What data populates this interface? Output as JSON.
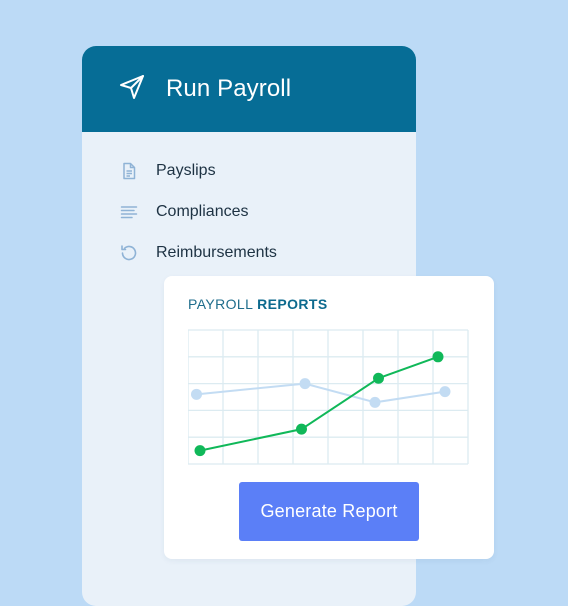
{
  "header": {
    "title": "Run Payroll",
    "icon": "send-icon"
  },
  "menu": {
    "items": [
      {
        "label": "Payslips",
        "icon": "document-icon"
      },
      {
        "label": "Compliances",
        "icon": "lines-icon"
      },
      {
        "label": "Reimbursements",
        "icon": "history-icon"
      }
    ]
  },
  "card": {
    "title_part1": "PAYROLL",
    "title_part2": "REPORTS",
    "button_label": "Generate Report"
  },
  "colors": {
    "header_bg": "#066d96",
    "panel_bg": "#e9f1f9",
    "page_bg": "#bcdaf6",
    "button_bg": "#5b7ff7",
    "series_primary": "#10b859",
    "series_secondary": "#c3dcf3"
  },
  "chart_data": {
    "type": "line",
    "title": "",
    "xlabel": "",
    "ylabel": "",
    "x": [
      1,
      2,
      3,
      4
    ],
    "xlim": [
      1,
      8
    ],
    "ylim": [
      0,
      5
    ],
    "grid": true,
    "series": [
      {
        "color": "#c3dcf3",
        "values": [
          2.6,
          3.0,
          2.3,
          2.7
        ],
        "x": [
          0.9,
          4.0,
          6.0,
          8.0
        ]
      },
      {
        "color": "#10b859",
        "values": [
          0.5,
          1.3,
          3.2,
          4.0
        ],
        "x": [
          1.0,
          3.9,
          6.1,
          7.8
        ]
      }
    ]
  }
}
